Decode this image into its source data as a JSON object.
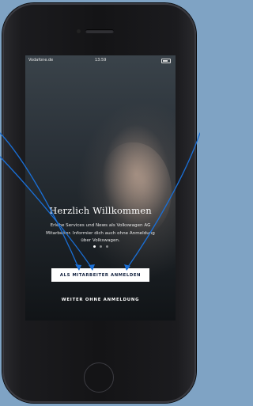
{
  "status_bar": {
    "carrier": "Vodafone.de",
    "time": "13:59"
  },
  "welcome": {
    "title": "Herzlich Willkommen",
    "subtitle_line1": "Erlebe Services und News als Volkswagen AG",
    "subtitle_line2": "Mitarbeiter. Informier dich auch ohne Anmeldung",
    "subtitle_line3": "über Volkswagen."
  },
  "pager": {
    "pages": 3,
    "active": 1
  },
  "actions": {
    "employee_login_label": "ALS MITARBEITER ANMELDEN",
    "continue_without_login_label": "WEITER OHNE ANMELDUNG"
  },
  "colors": {
    "annotation_line": "#1a6fd6",
    "primary_button_text": "#0d1c3a",
    "background": "#7fa3c4"
  }
}
